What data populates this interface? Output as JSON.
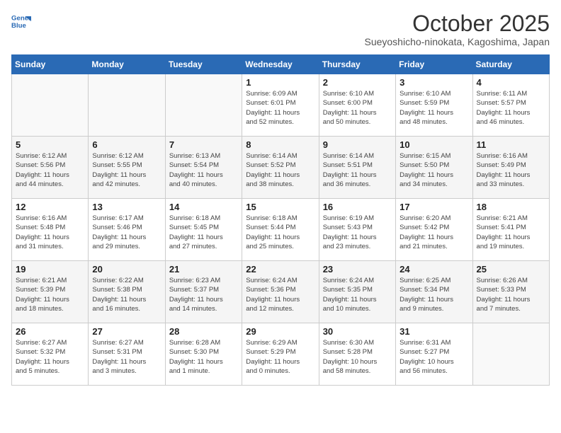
{
  "header": {
    "logo_line1": "General",
    "logo_line2": "Blue",
    "month": "October 2025",
    "location": "Sueyoshicho-ninokata, Kagoshima, Japan"
  },
  "weekdays": [
    "Sunday",
    "Monday",
    "Tuesday",
    "Wednesday",
    "Thursday",
    "Friday",
    "Saturday"
  ],
  "weeks": [
    [
      {
        "day": "",
        "info": ""
      },
      {
        "day": "",
        "info": ""
      },
      {
        "day": "",
        "info": ""
      },
      {
        "day": "1",
        "info": "Sunrise: 6:09 AM\nSunset: 6:01 PM\nDaylight: 11 hours\nand 52 minutes."
      },
      {
        "day": "2",
        "info": "Sunrise: 6:10 AM\nSunset: 6:00 PM\nDaylight: 11 hours\nand 50 minutes."
      },
      {
        "day": "3",
        "info": "Sunrise: 6:10 AM\nSunset: 5:59 PM\nDaylight: 11 hours\nand 48 minutes."
      },
      {
        "day": "4",
        "info": "Sunrise: 6:11 AM\nSunset: 5:57 PM\nDaylight: 11 hours\nand 46 minutes."
      }
    ],
    [
      {
        "day": "5",
        "info": "Sunrise: 6:12 AM\nSunset: 5:56 PM\nDaylight: 11 hours\nand 44 minutes."
      },
      {
        "day": "6",
        "info": "Sunrise: 6:12 AM\nSunset: 5:55 PM\nDaylight: 11 hours\nand 42 minutes."
      },
      {
        "day": "7",
        "info": "Sunrise: 6:13 AM\nSunset: 5:54 PM\nDaylight: 11 hours\nand 40 minutes."
      },
      {
        "day": "8",
        "info": "Sunrise: 6:14 AM\nSunset: 5:52 PM\nDaylight: 11 hours\nand 38 minutes."
      },
      {
        "day": "9",
        "info": "Sunrise: 6:14 AM\nSunset: 5:51 PM\nDaylight: 11 hours\nand 36 minutes."
      },
      {
        "day": "10",
        "info": "Sunrise: 6:15 AM\nSunset: 5:50 PM\nDaylight: 11 hours\nand 34 minutes."
      },
      {
        "day": "11",
        "info": "Sunrise: 6:16 AM\nSunset: 5:49 PM\nDaylight: 11 hours\nand 33 minutes."
      }
    ],
    [
      {
        "day": "12",
        "info": "Sunrise: 6:16 AM\nSunset: 5:48 PM\nDaylight: 11 hours\nand 31 minutes."
      },
      {
        "day": "13",
        "info": "Sunrise: 6:17 AM\nSunset: 5:46 PM\nDaylight: 11 hours\nand 29 minutes."
      },
      {
        "day": "14",
        "info": "Sunrise: 6:18 AM\nSunset: 5:45 PM\nDaylight: 11 hours\nand 27 minutes."
      },
      {
        "day": "15",
        "info": "Sunrise: 6:18 AM\nSunset: 5:44 PM\nDaylight: 11 hours\nand 25 minutes."
      },
      {
        "day": "16",
        "info": "Sunrise: 6:19 AM\nSunset: 5:43 PM\nDaylight: 11 hours\nand 23 minutes."
      },
      {
        "day": "17",
        "info": "Sunrise: 6:20 AM\nSunset: 5:42 PM\nDaylight: 11 hours\nand 21 minutes."
      },
      {
        "day": "18",
        "info": "Sunrise: 6:21 AM\nSunset: 5:41 PM\nDaylight: 11 hours\nand 19 minutes."
      }
    ],
    [
      {
        "day": "19",
        "info": "Sunrise: 6:21 AM\nSunset: 5:39 PM\nDaylight: 11 hours\nand 18 minutes."
      },
      {
        "day": "20",
        "info": "Sunrise: 6:22 AM\nSunset: 5:38 PM\nDaylight: 11 hours\nand 16 minutes."
      },
      {
        "day": "21",
        "info": "Sunrise: 6:23 AM\nSunset: 5:37 PM\nDaylight: 11 hours\nand 14 minutes."
      },
      {
        "day": "22",
        "info": "Sunrise: 6:24 AM\nSunset: 5:36 PM\nDaylight: 11 hours\nand 12 minutes."
      },
      {
        "day": "23",
        "info": "Sunrise: 6:24 AM\nSunset: 5:35 PM\nDaylight: 11 hours\nand 10 minutes."
      },
      {
        "day": "24",
        "info": "Sunrise: 6:25 AM\nSunset: 5:34 PM\nDaylight: 11 hours\nand 9 minutes."
      },
      {
        "day": "25",
        "info": "Sunrise: 6:26 AM\nSunset: 5:33 PM\nDaylight: 11 hours\nand 7 minutes."
      }
    ],
    [
      {
        "day": "26",
        "info": "Sunrise: 6:27 AM\nSunset: 5:32 PM\nDaylight: 11 hours\nand 5 minutes."
      },
      {
        "day": "27",
        "info": "Sunrise: 6:27 AM\nSunset: 5:31 PM\nDaylight: 11 hours\nand 3 minutes."
      },
      {
        "day": "28",
        "info": "Sunrise: 6:28 AM\nSunset: 5:30 PM\nDaylight: 11 hours\nand 1 minute."
      },
      {
        "day": "29",
        "info": "Sunrise: 6:29 AM\nSunset: 5:29 PM\nDaylight: 11 hours\nand 0 minutes."
      },
      {
        "day": "30",
        "info": "Sunrise: 6:30 AM\nSunset: 5:28 PM\nDaylight: 10 hours\nand 58 minutes."
      },
      {
        "day": "31",
        "info": "Sunrise: 6:31 AM\nSunset: 5:27 PM\nDaylight: 10 hours\nand 56 minutes."
      },
      {
        "day": "",
        "info": ""
      }
    ]
  ]
}
